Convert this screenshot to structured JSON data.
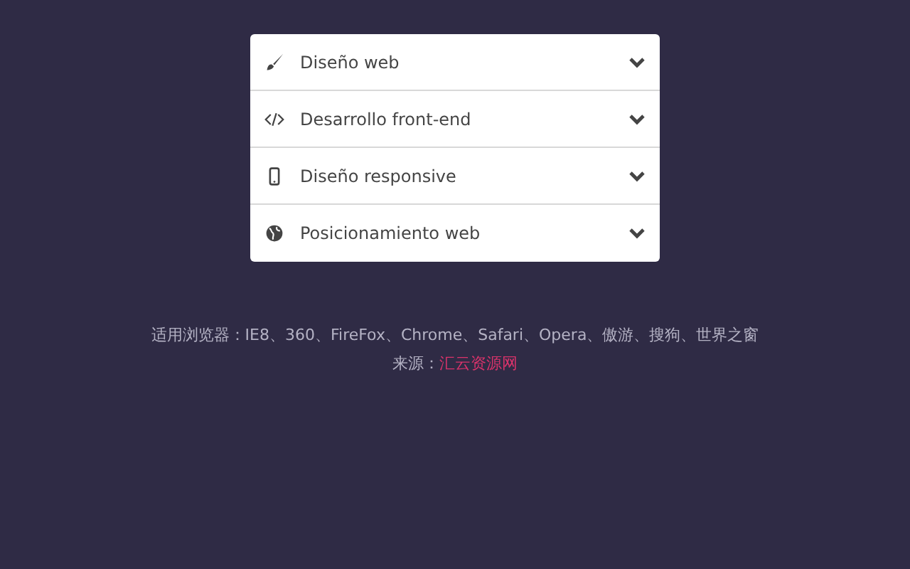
{
  "accordion": [
    {
      "kind": "brush",
      "label": "Diseño web",
      "expanded": false
    },
    {
      "kind": "code",
      "label": "Desarrollo front-end",
      "expanded": false
    },
    {
      "kind": "phone",
      "label": "Diseño responsive",
      "expanded": false
    },
    {
      "kind": "globe",
      "label": "Posicionamiento web",
      "expanded": false
    }
  ],
  "browsers_note": "适用浏览器：IE8、360、FireFox、Chrome、Safari、Opera、傲游、搜狗、世界之窗",
  "source": {
    "label": "来源：",
    "link": "汇云资源网"
  }
}
